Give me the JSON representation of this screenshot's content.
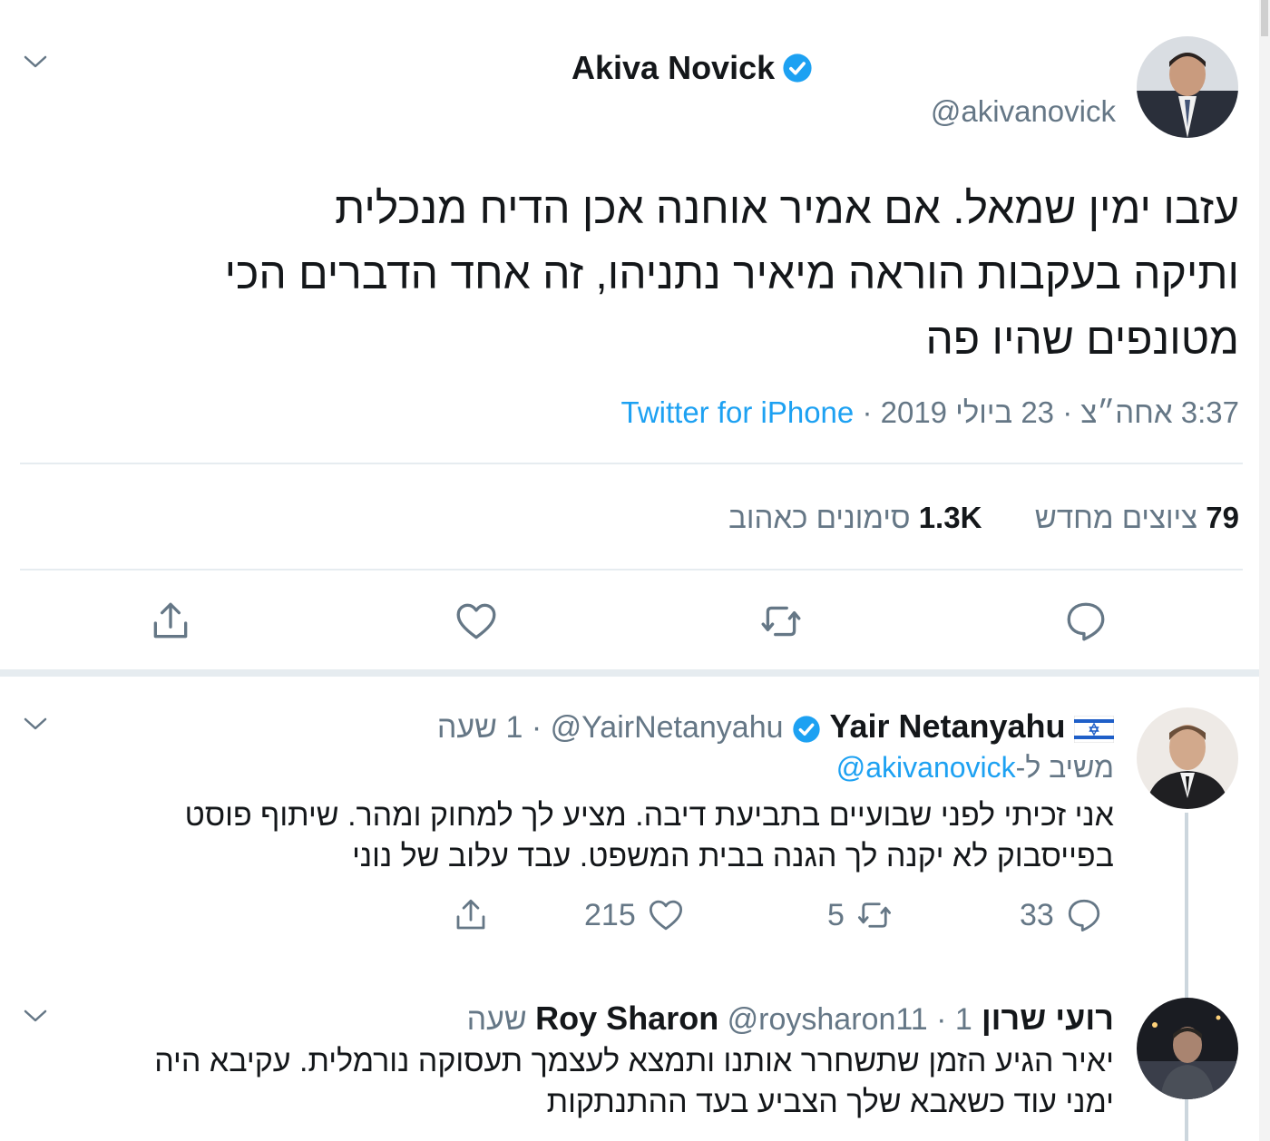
{
  "main_tweet": {
    "author_name": "Akiva Novick",
    "handle": "@akivanovick",
    "text_lines": [
      "עזבו ימין שמאל. אם אמיר אוחנה אכן הדיח מנכלית",
      "ותיקה בעקבות הוראה מיאיר נתניהו, זה אחד הדברים הכי",
      "מטונפים שהיו פה"
    ],
    "timestamp": "3:37 אחה״צ · 23 ביולי 2019 ·",
    "source": "Twitter for iPhone",
    "retweets_count": "79",
    "retweets_label": "ציוצים מחדש",
    "likes_count": "1.3K",
    "likes_label": "סימונים כאהוב"
  },
  "reply_1": {
    "author_name": "Yair Netanyahu",
    "handle": "@YairNetanyahu",
    "time": "1 שעה",
    "replying_label": "משיב ל-",
    "replying_to": "@akivanovick",
    "text_lines": [
      "אני זכיתי לפני שבועיים בתביעת דיבה. מציע לך למחוק ומהר. שיתוף פוסט",
      "בפייסבוק לא יקנה לך הגנה בבית המשפט. עבד עלוב של נוני"
    ],
    "replies": "33",
    "retweets": "5",
    "likes": "215"
  },
  "reply_2": {
    "author_name": "רועי שרון Roy Sharon",
    "handle": "@roysharon11",
    "time": "1 שעה",
    "text_lines": [
      "יאיר הגיע הזמן שתשחרר אותנו ותמצא לעצמך תעסוקה נורמלית. עקיבא היה",
      "ימני עוד כשאבא שלך הצביע בעד ההתנתקות"
    ]
  },
  "colors": {
    "accent": "#1da1f2",
    "secondary_text": "#657786",
    "divider": "#e6ecf0"
  },
  "icons": {
    "caret": "chevron-down-icon",
    "verified": "verified-badge-icon",
    "reply": "reply-icon",
    "retweet": "retweet-icon",
    "like": "heart-icon",
    "share": "share-icon",
    "flag": "israel-flag-icon"
  }
}
